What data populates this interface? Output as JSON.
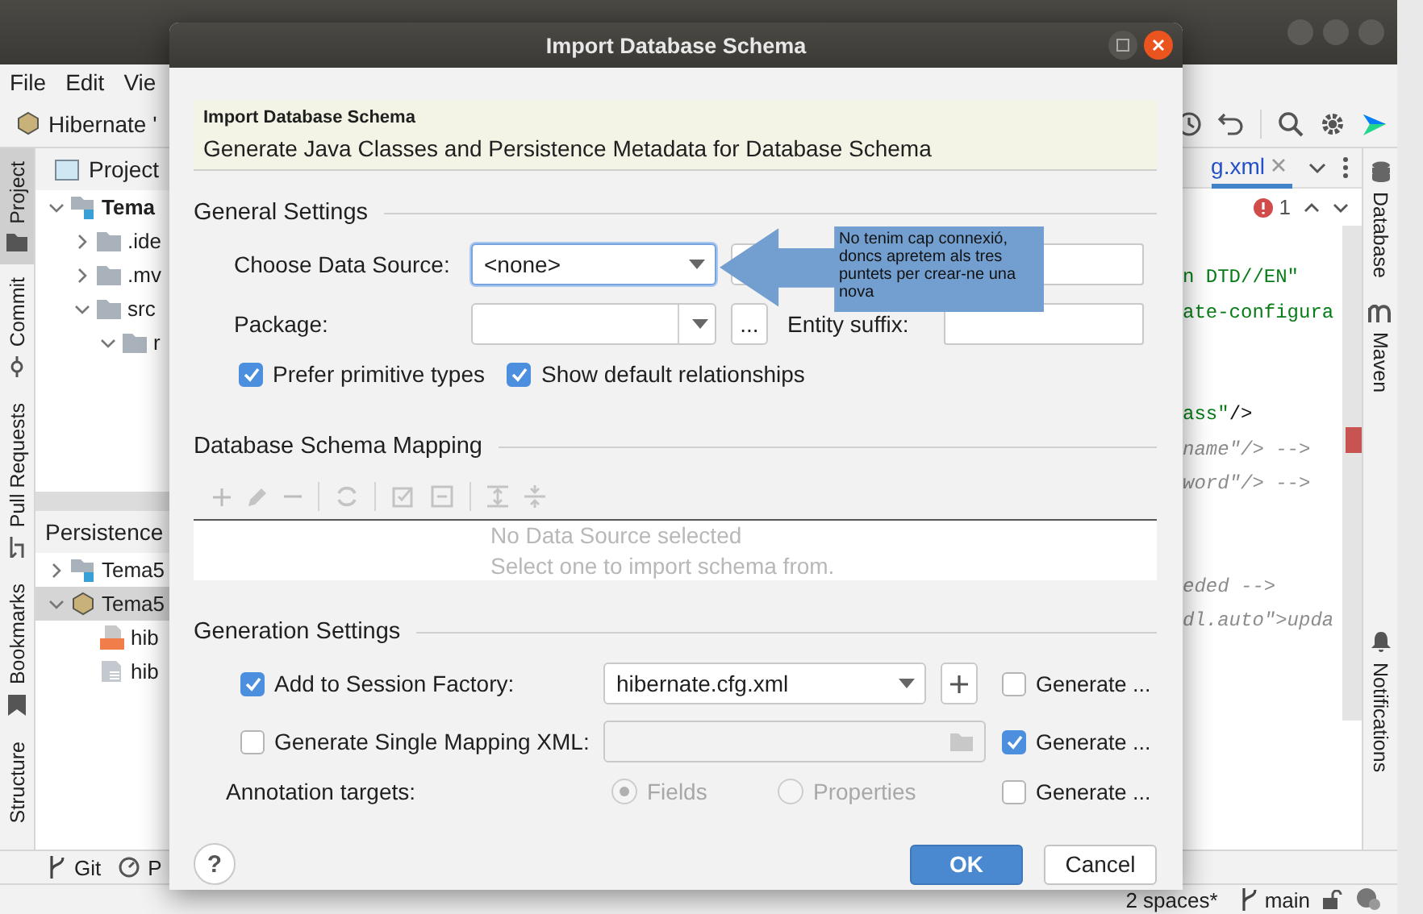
{
  "menu": [
    {
      "label": "File"
    },
    {
      "label": "Edit"
    },
    {
      "label": "Vie"
    }
  ],
  "toolbar": {
    "project": "Hibernate '"
  },
  "left_strip": [
    {
      "label": "Project",
      "selected": true
    },
    {
      "label": "Commit",
      "selected": false
    },
    {
      "label": "Pull Requests",
      "selected": false
    },
    {
      "label": "Bookmarks",
      "selected": false
    },
    {
      "label": "Structure",
      "selected": false
    }
  ],
  "project_panel": {
    "title": "Project",
    "tree": [
      {
        "label": "Tema",
        "kind": "module",
        "expanded": true,
        "children": [
          {
            "label": ".ide",
            "kind": "folder",
            "expanded": false
          },
          {
            "label": ".mv",
            "kind": "folder",
            "expanded": false
          },
          {
            "label": "src",
            "kind": "folder",
            "expanded": true,
            "children": [
              {
                "label": "r",
                "kind": "folder",
                "expanded": true
              }
            ]
          }
        ]
      }
    ]
  },
  "persistence_panel": {
    "title": "Persistence",
    "items": [
      {
        "label": "Tema5",
        "kind": "module",
        "expanded": false,
        "selected": false
      },
      {
        "label": "Tema5",
        "kind": "hibernate",
        "expanded": true,
        "selected": true,
        "children": [
          {
            "label": "hib",
            "kind": "xml"
          },
          {
            "label": "hib",
            "kind": "cfg"
          }
        ]
      }
    ]
  },
  "bottom_tabs": [
    {
      "label": "Git"
    },
    {
      "label": "P"
    }
  ],
  "editor": {
    "tab": "g.xml",
    "errors": "1",
    "blocks": [
      [
        [
          {
            "text": "n DTD//EN\"",
            "kind": "string"
          }
        ],
        [
          {
            "text": "ate-configura",
            "kind": "string"
          }
        ]
      ],
      [
        [
          {
            "text": "ass\"",
            "kind": "string"
          },
          {
            "text": "/>",
            "kind": "tag"
          }
        ],
        [
          {
            "text": "name\"/> -->",
            "kind": "comment"
          }
        ],
        [
          {
            "text": "word\"/> -->",
            "kind": "comment"
          }
        ]
      ],
      [
        [
          {
            "text": "eded -->",
            "kind": "comment"
          }
        ],
        [
          {
            "text": "dl.auto\">upda",
            "kind": "comment"
          }
        ]
      ]
    ]
  },
  "right_strip": [
    {
      "label": "Database"
    },
    {
      "label": "Maven"
    },
    {
      "label": "Notifications"
    }
  ],
  "status_bar": {
    "indent": "2 spaces*",
    "branch": "main"
  },
  "dialog": {
    "title": "Import Database Schema",
    "header": {
      "title": "Import Database Schema",
      "subtitle": "Generate Java Classes and Persistence Metadata for Database Schema"
    },
    "general": {
      "title": "General Settings",
      "data_source_label": "Choose Data Source:",
      "data_source": "<none>",
      "package_label": "Package:",
      "browse": "...",
      "entity_suffix_label": "Entity suffix:",
      "options": [
        {
          "label": "Prefer primitive types",
          "checked": true
        },
        {
          "label": "Show default relationships",
          "checked": true
        }
      ]
    },
    "mapping": {
      "title": "Database Schema Mapping",
      "empty": [
        "No Data Source selected",
        "Select one to import schema from."
      ]
    },
    "generation": {
      "title": "Generation Settings",
      "session_factory": {
        "label": "Add to Session Factory:",
        "checked": true,
        "value": "hibernate.cfg.xml"
      },
      "single_xml": {
        "label": "Generate Single Mapping XML:",
        "checked": false
      },
      "annotation_label": "Annotation targets:",
      "targets": [
        {
          "label": "Fields",
          "selected": true
        },
        {
          "label": "Properties",
          "selected": false
        }
      ],
      "generate": [
        {
          "label": "Generate ...",
          "checked": false
        },
        {
          "label": "Generate ...",
          "checked": true
        },
        {
          "label": "Generate ...",
          "checked": false
        }
      ]
    },
    "buttons": [
      {
        "label": "OK",
        "kind": "primary"
      },
      {
        "label": "Cancel",
        "kind": "secondary"
      }
    ],
    "help": "?"
  },
  "callout": {
    "text": "No tenim cap connexió, doncs apretem als tres puntets per crear-ne una nova"
  }
}
